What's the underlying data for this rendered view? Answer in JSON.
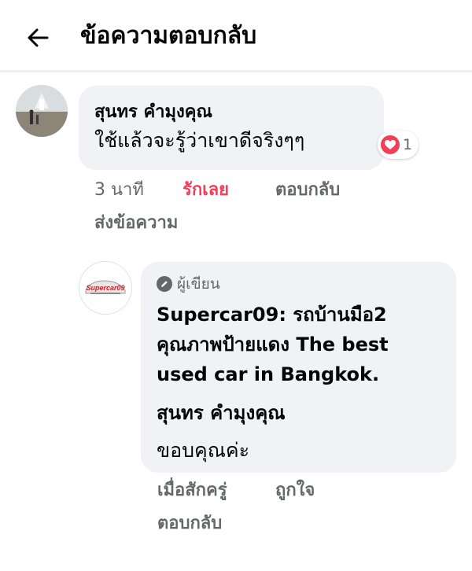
{
  "header": {
    "title": "ข้อความตอบกลับ"
  },
  "comment": {
    "author": "สุนทร คำมุงคุณ",
    "text": "ใช้แล้วจะรู้ว่าเขาดีจริงๆๆ",
    "reaction_count": "1",
    "actions": {
      "time": "3 นาที",
      "like": "รักเลย",
      "reply": "ตอบกลับ",
      "send_message": "ส่งข้อความ"
    }
  },
  "reply": {
    "badge": "ผู้เขียน",
    "page_name": "Supercar09: รถบ้านมือ2 คุณภาพป้ายแดง The best used car in Bangkok.",
    "tagged_user": "สุนทร คำมุงคุณ",
    "text": "ขอบคุณค่ะ",
    "logo_text": "Supercar09",
    "actions": {
      "time": "เมื่อสักครู่",
      "like": "ถูกใจ",
      "reply": "ตอบกลับ"
    }
  },
  "colors": {
    "secondary_text": "#65676b",
    "love_reaction": "#f33e58",
    "bubble_bg": "#f0f2f5"
  }
}
